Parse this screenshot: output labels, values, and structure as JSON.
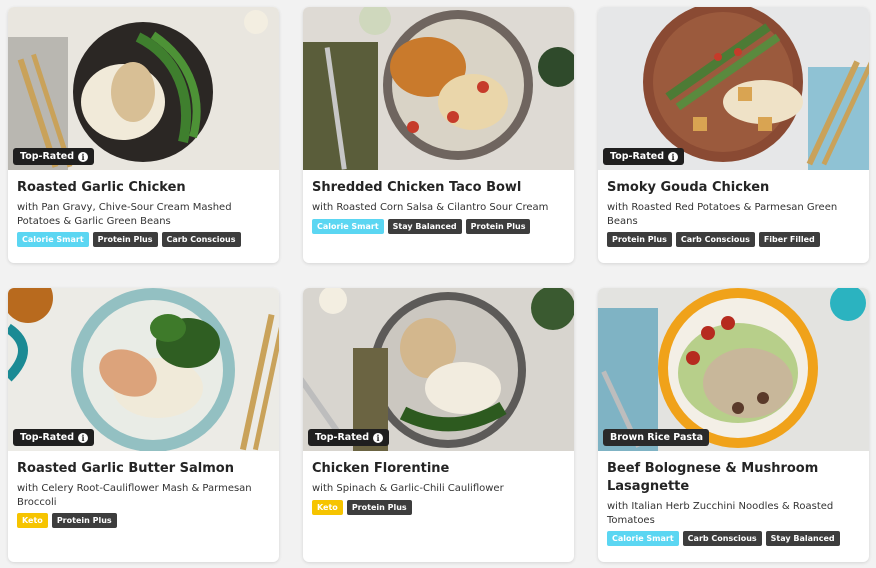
{
  "colors": {
    "calorie_smart": "#5bd6f2",
    "keto": "#f6c400",
    "dark_tag": "#3d3d3d",
    "badge": "#1f1f1f"
  },
  "cards": [
    {
      "title": "Roasted Garlic Chicken",
      "subtitle": "with Pan Gravy, Chive-Sour Cream Mashed Potatoes & Garlic Green Beans",
      "badge": "Top-Rated",
      "tags": [
        "Calorie Smart",
        "Protein Plus",
        "Carb Conscious"
      ]
    },
    {
      "title": "Shredded Chicken Taco Bowl",
      "subtitle": "with Roasted Corn Salsa & Cilantro Sour Cream",
      "badge": "",
      "tags": [
        "Calorie Smart",
        "Stay Balanced",
        "Protein Plus"
      ]
    },
    {
      "title": "Smoky Gouda Chicken",
      "subtitle": "with Roasted Red Potatoes & Parmesan Green Beans",
      "badge": "Top-Rated",
      "tags": [
        "Protein Plus",
        "Carb Conscious",
        "Fiber Filled"
      ]
    },
    {
      "title": "Roasted Garlic Butter Salmon",
      "subtitle": "with Celery Root-Cauliflower Mash & Parmesan Broccoli",
      "badge": "Top-Rated",
      "tags": [
        "Keto",
        "Protein Plus"
      ]
    },
    {
      "title": "Chicken Florentine",
      "subtitle": "with Spinach & Garlic-Chili Cauliflower",
      "badge": "Top-Rated",
      "tags": [
        "Keto",
        "Protein Plus"
      ]
    },
    {
      "title": "Beef Bolognese & Mushroom Lasagnette",
      "subtitle": "with Italian Herb Zucchini Noodles & Roasted Tomatoes",
      "badge": "Brown Rice Pasta",
      "tags": [
        "Calorie Smart",
        "Carb Conscious",
        "Stay Balanced"
      ]
    }
  ],
  "icons": {
    "info": "info-icon"
  }
}
